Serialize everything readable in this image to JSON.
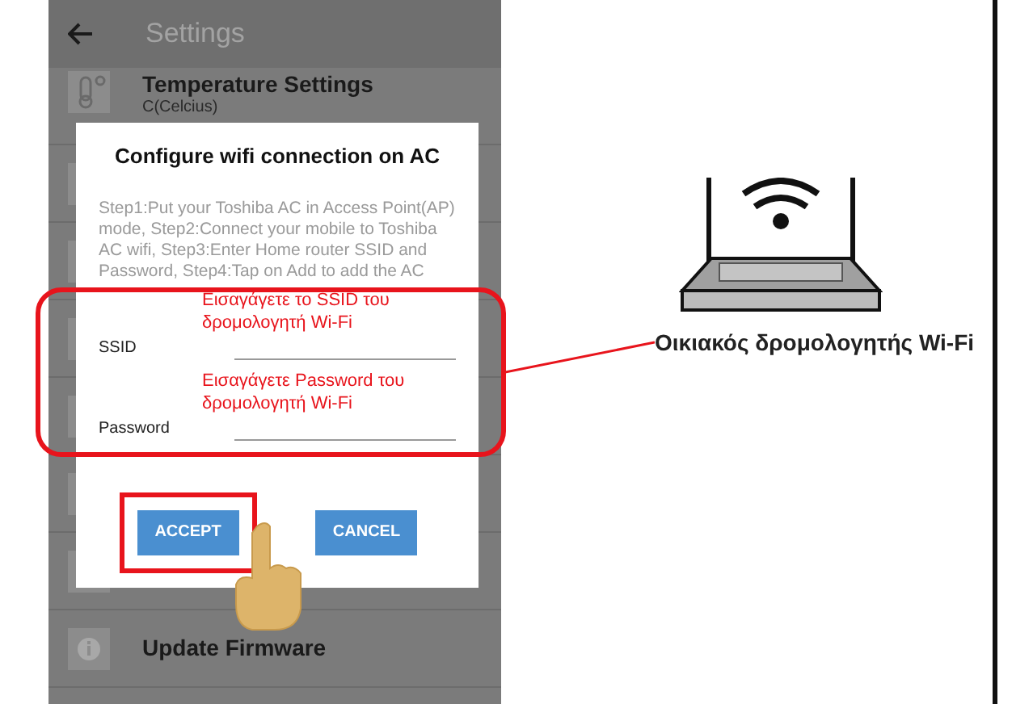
{
  "app_bar": {
    "title": "Settings"
  },
  "settings_rows": [
    {
      "kind": "thermo",
      "title": "Temperature Settings",
      "subtitle": "C(Celcius)"
    },
    {
      "kind": "plain"
    },
    {
      "kind": "plain"
    },
    {
      "kind": "plain"
    },
    {
      "kind": "plain"
    },
    {
      "kind": "plain"
    },
    {
      "kind": "info"
    },
    {
      "kind": "info",
      "title": "Update Firmware"
    }
  ],
  "dialog": {
    "title": "Configure wifi connection on AC",
    "instructions": "Step1:Put your Toshiba AC in Access Point(AP) mode, Step2:Connect your mobile to Toshiba AC wifi,  Step3:Enter Home router SSID and Password, Step4:Tap on Add to add the AC",
    "fields": [
      {
        "label": "SSID",
        "note": "Εισαγάγετε το SSID του δρομολογητή Wi-Fi"
      },
      {
        "label": "Password",
        "note": "Εισαγάγετε Password του δρομολογητή Wi-Fi"
      }
    ],
    "buttons": [
      {
        "label": "ACCEPT",
        "highlighted": true
      },
      {
        "label": "CANCEL",
        "highlighted": false
      }
    ]
  },
  "router": {
    "label": "Οικιακός δρομολογητής Wi-Fi"
  }
}
